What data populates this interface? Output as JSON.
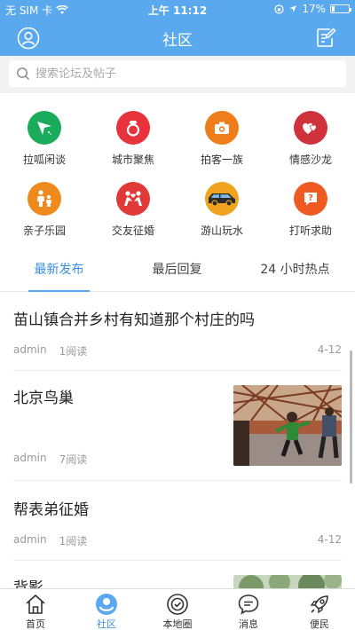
{
  "status_bar": {
    "carrier": "无 SIM 卡",
    "time": "上午 11:12",
    "battery": "17%",
    "battery_level": 0.17
  },
  "header": {
    "title": "社区"
  },
  "search": {
    "placeholder": "搜索论坛及帖子"
  },
  "categories": [
    {
      "label": "拉呱闲谈",
      "color": "#1aab5b",
      "icon": "paper-plane-icon"
    },
    {
      "label": "城市聚焦",
      "color": "#e8323c",
      "icon": "ring-icon"
    },
    {
      "label": "拍客一族",
      "color": "#ef7d1a",
      "icon": "camera-icon"
    },
    {
      "label": "情感沙龙",
      "color": "#d0323c",
      "icon": "hearts-icon"
    },
    {
      "label": "亲子乐园",
      "color": "#ef8a1e",
      "icon": "parent-child-icon"
    },
    {
      "label": "交友征婚",
      "color": "#e03a38",
      "icon": "couple-icon"
    },
    {
      "label": "游山玩水",
      "color": "#f0a31e",
      "icon": "car-icon"
    },
    {
      "label": "打听求助",
      "color": "#ef5a22",
      "icon": "question-icon"
    }
  ],
  "tabs": [
    {
      "label": "最新发布",
      "active": true
    },
    {
      "label": "最后回复",
      "active": false
    },
    {
      "label": "24 小时热点",
      "active": false
    }
  ],
  "posts": [
    {
      "title": "苗山镇合并乡村有知道那个村庄的吗",
      "author": "admin",
      "reads": "1阅读",
      "date": "4-12",
      "has_image": false
    },
    {
      "title": "北京鸟巢",
      "author": "admin",
      "reads": "7阅读",
      "date": "",
      "has_image": true
    },
    {
      "title": "帮表弟征婚",
      "author": "admin",
      "reads": "1阅读",
      "date": "4-12",
      "has_image": false
    },
    {
      "title": "背影",
      "author": "",
      "reads": "",
      "date": "",
      "has_image": true
    }
  ],
  "tab_bar": [
    {
      "label": "首页",
      "icon": "home-icon",
      "active": false
    },
    {
      "label": "社区",
      "icon": "community-icon",
      "active": true
    },
    {
      "label": "本地圈",
      "icon": "local-circle-icon",
      "active": false
    },
    {
      "label": "消息",
      "icon": "message-icon",
      "active": false
    },
    {
      "label": "便民",
      "icon": "rocket-icon",
      "active": false
    }
  ],
  "colors": {
    "primary": "#5aa8ee",
    "accent_text": "#3a8fe0"
  }
}
